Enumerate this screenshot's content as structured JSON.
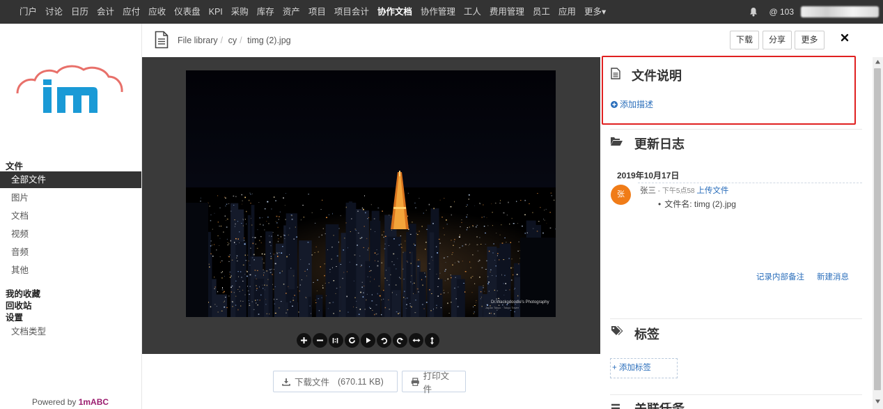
{
  "nav": {
    "items": [
      "门户",
      "讨论",
      "日历",
      "会计",
      "应付",
      "应收",
      "仪表盘",
      "KPI",
      "采购",
      "库存",
      "资产",
      "项目",
      "项目会计",
      "协作文档",
      "协作管理",
      "工人",
      "费用管理",
      "员工",
      "应用",
      "更多▾"
    ],
    "active_index": 13,
    "at_count": "@ 103"
  },
  "sidebar": {
    "section_files": "文件",
    "items": [
      "全部文件",
      "图片",
      "文档",
      "视频",
      "音频",
      "其他"
    ],
    "active_index": 0,
    "favorites": "我的收藏",
    "recycle": "回收站",
    "settings": "设置",
    "doc_types": "文档类型",
    "powered_prefix": "Powered by ",
    "powered_brand": "1mABC"
  },
  "header": {
    "breadcrumb": [
      "File library",
      "cy",
      "timg (2).jpg"
    ],
    "download": "下载",
    "share": "分享",
    "more": "更多"
  },
  "viewer": {
    "watermark_line1": "Dr.Wackodoodle's Photography",
    "watermark_line2": "Japan Tokyo · Tokyo Tower"
  },
  "bottom": {
    "download_label": "下载文件",
    "download_size": "(670.11 KB)",
    "print_label": "打印文件"
  },
  "panel": {
    "description_title": "文件说明",
    "add_description": "添加描述",
    "log_title": "更新日志",
    "log_date": "2019年10月17日",
    "log_user": "张三",
    "log_time": " - 下午5点58 ",
    "log_action": "上传文件",
    "log_detail": "文件名: timg (2).jpg",
    "avatar_text": "张",
    "internal_note": "记录内部备注",
    "new_message": "新建消息",
    "tags_title": "标签",
    "add_tag": "+ 添加标签",
    "related_title": "关联任务"
  },
  "colors": {
    "nav_bg": "#333333",
    "link": "#2a6ebb",
    "highlight_border": "#e02020",
    "avatar": "#f07c18"
  }
}
